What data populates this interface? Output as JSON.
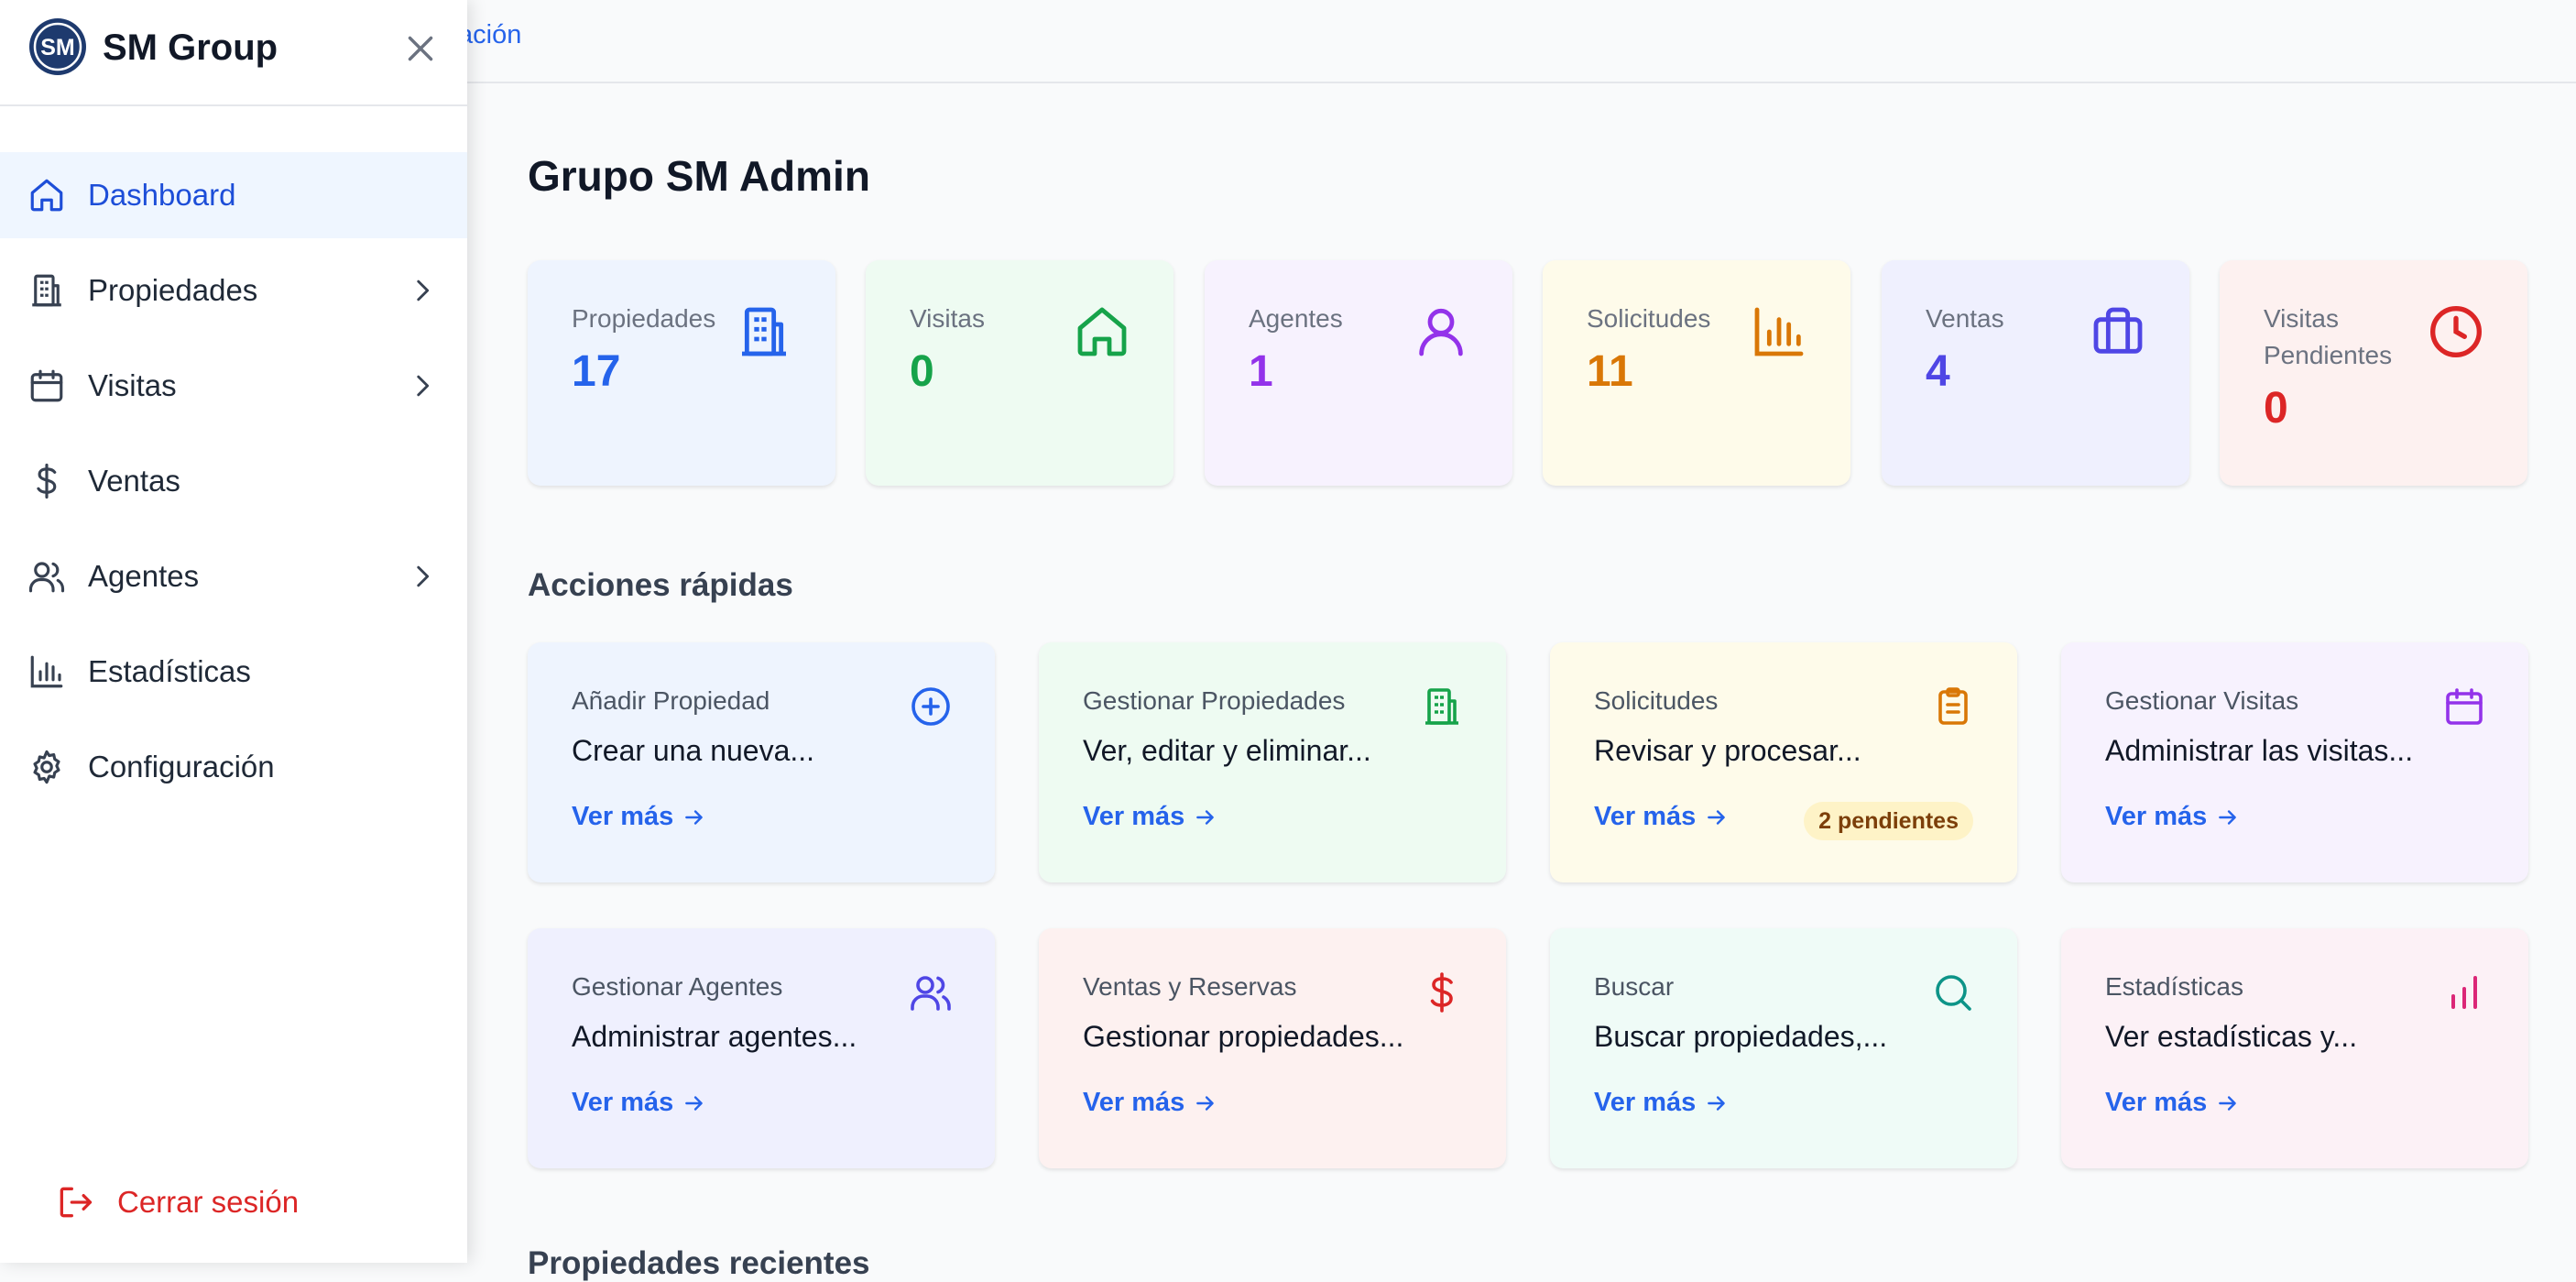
{
  "topbar": {
    "partial_link": "ación"
  },
  "sidebar": {
    "brand": "SM Group",
    "logo_text": "SM",
    "items": [
      {
        "label": "Dashboard",
        "icon": "home-icon",
        "active": true,
        "has_chevron": false
      },
      {
        "label": "Propiedades",
        "icon": "building-icon",
        "active": false,
        "has_chevron": true
      },
      {
        "label": "Visitas",
        "icon": "calendar-icon",
        "active": false,
        "has_chevron": true
      },
      {
        "label": "Ventas",
        "icon": "dollar-icon",
        "active": false,
        "has_chevron": false
      },
      {
        "label": "Agentes",
        "icon": "users-icon",
        "active": false,
        "has_chevron": true
      },
      {
        "label": "Estadísticas",
        "icon": "bar-chart-icon",
        "active": false,
        "has_chevron": false
      },
      {
        "label": "Configuración",
        "icon": "gear-icon",
        "active": false,
        "has_chevron": false
      }
    ],
    "logout_label": "Cerrar sesión"
  },
  "main": {
    "title": "Grupo SM Admin",
    "stats": [
      {
        "label": "Propiedades",
        "value": "17",
        "icon": "building-icon",
        "color": "#2563eb",
        "bg": "#eef4fe"
      },
      {
        "label": "Visitas",
        "value": "0",
        "icon": "home-icon",
        "color": "#16a34a",
        "bg": "#eefbf2"
      },
      {
        "label": "Agentes",
        "value": "1",
        "icon": "user-icon",
        "color": "#9333ea",
        "bg": "#f7f2fe"
      },
      {
        "label": "Solicitudes",
        "value": "11",
        "icon": "bar-chart-icon",
        "color": "#d97706",
        "bg": "#fefbea"
      },
      {
        "label": "Ventas",
        "value": "4",
        "icon": "briefcase-icon",
        "color": "#4f46e5",
        "bg": "#eff0fe"
      },
      {
        "label": "Visitas Pendientes",
        "value": "0",
        "icon": "clock-icon",
        "color": "#dc2626",
        "bg": "#fdf1f0"
      }
    ],
    "quick_actions_title": "Acciones rápidas",
    "more_label": "Ver más",
    "quick_actions": [
      {
        "title": "Añadir Propiedad",
        "desc": "Crear una nueva...",
        "icon": "plus-circle-icon",
        "color": "#2563eb",
        "bg": "#eef4fe"
      },
      {
        "title": "Gestionar Propiedades",
        "desc": "Ver, editar y eliminar...",
        "icon": "building-icon",
        "color": "#16a34a",
        "bg": "#eefbf2"
      },
      {
        "title": "Solicitudes",
        "desc": "Revisar y procesar...",
        "icon": "clipboard-icon",
        "color": "#d97706",
        "bg": "#fefbea",
        "badge": "2 pendientes"
      },
      {
        "title": "Gestionar Visitas",
        "desc": "Administrar las visitas...",
        "icon": "calendar-icon",
        "color": "#9333ea",
        "bg": "#f7f2fe"
      },
      {
        "title": "Gestionar Agentes",
        "desc": "Administrar agentes...",
        "icon": "users-icon",
        "color": "#4f46e5",
        "bg": "#eff0fe"
      },
      {
        "title": "Ventas y Reservas",
        "desc": "Gestionar propiedades...",
        "icon": "dollar-icon",
        "color": "#dc2626",
        "bg": "#fdf1f0"
      },
      {
        "title": "Buscar",
        "desc": "Buscar propiedades,...",
        "icon": "search-icon",
        "color": "#0d9488",
        "bg": "#effbf7"
      },
      {
        "title": "Estadísticas",
        "desc": "Ver estadísticas y...",
        "icon": "bar-chart-icon",
        "color": "#db2777",
        "bg": "#fcf1f6"
      }
    ],
    "next_section_title": "Propiedades recientes"
  }
}
